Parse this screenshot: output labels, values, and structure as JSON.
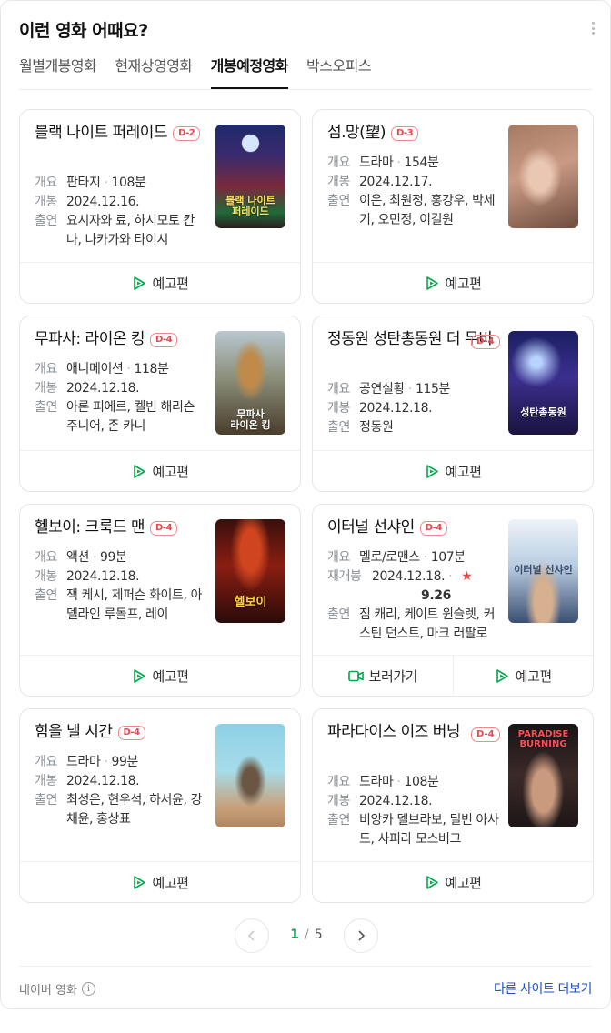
{
  "header": {
    "title": "이런 영화 어때요?"
  },
  "tabs": [
    {
      "label": "월별개봉영화",
      "active": false
    },
    {
      "label": "현재상영영화",
      "active": false
    },
    {
      "label": "개봉예정영화",
      "active": true
    },
    {
      "label": "박스오피스",
      "active": false
    }
  ],
  "labels": {
    "genre": "개요",
    "release": "개봉",
    "rerelease": "재개봉",
    "cast": "출연"
  },
  "buttons": {
    "trailer": "예고편",
    "watch": "보러가기"
  },
  "movies": [
    {
      "title": "블랙 나이트 퍼레이드",
      "dday": "D-2",
      "genre": "판타지",
      "runtime": "108분",
      "date": "2024.12.16.",
      "cast": "요시자와 료, 하시모토 칸나, 나카가와 타이시",
      "poster_text": "블랙 나이트\n퍼레이드"
    },
    {
      "title": "섬.망(望)",
      "dday": "D-3",
      "genre": "드라마",
      "runtime": "154분",
      "date": "2024.12.17.",
      "cast": "이은, 최원정, 홍강우, 박세기, 오민정, 이길원"
    },
    {
      "title": "무파사: 라이온 킹",
      "dday": "D-4",
      "genre": "애니메이션",
      "runtime": "118분",
      "date": "2024.12.18.",
      "cast": "아론 피에르, 켈빈 해리슨 주니어, 존 카니",
      "poster_text": "무파사\n라이온 킹"
    },
    {
      "title": "정동원 성탄총동원 더 무비",
      "dday": "D-4",
      "genre": "공연실황",
      "runtime": "115분",
      "date": "2024.12.18.",
      "cast": "정동원",
      "poster_text": "성탄총동원"
    },
    {
      "title": "헬보이: 크룩드 맨",
      "dday": "D-4",
      "genre": "액션",
      "runtime": "99분",
      "date": "2024.12.18.",
      "cast": "잭 케시, 제퍼슨 화이트, 아델라인 루돌프, 레이",
      "poster_text": "헬보이"
    },
    {
      "title": "이터널 선샤인",
      "dday": "D-4",
      "genre": "멜로/로맨스",
      "runtime": "107분",
      "date": "2024.12.18.",
      "rating": "9.26",
      "cast": "짐 캐리, 케이트 윈슬렛, 커스틴 던스트, 마크 러팔로",
      "poster_text": "이터널 선샤인"
    },
    {
      "title": "힘을 낼 시간",
      "dday": "D-4",
      "genre": "드라마",
      "runtime": "99분",
      "date": "2024.12.18.",
      "cast": "최성은, 현우석, 하서윤, 강채윤, 홍상표"
    },
    {
      "title": "파라다이스 이즈 버닝",
      "dday": "D-4",
      "genre": "드라마",
      "runtime": "108분",
      "date": "2024.12.18.",
      "cast": "비앙카 델브라보, 딜빈 아사드, 사피라 모스버그",
      "poster_text": "PARADISE\nBURNING"
    }
  ],
  "pager": {
    "current": "1",
    "sep": "/",
    "total": "5"
  },
  "footer": {
    "source": "네이버 영화",
    "info_glyph": "i",
    "more_link": "다른 사이트 더보기"
  },
  "colors": {
    "accent_green": "#03a94d",
    "dday_red": "#e8484c",
    "link_blue": "#1c4ec4"
  }
}
